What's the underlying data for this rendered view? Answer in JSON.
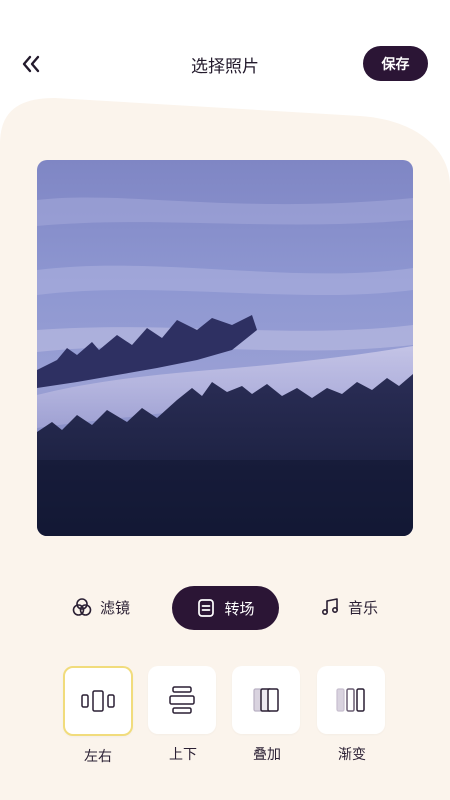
{
  "header": {
    "title": "选择照片",
    "save_label": "保存"
  },
  "tabs": [
    {
      "label": "滤镜",
      "icon": "filter-circles-icon",
      "active": false
    },
    {
      "label": "转场",
      "icon": "transition-icon",
      "active": true
    },
    {
      "label": "音乐",
      "icon": "music-note-icon",
      "active": false
    }
  ],
  "transitions": [
    {
      "label": "左右",
      "icon": "left-right-bars-icon",
      "selected": true
    },
    {
      "label": "上下",
      "icon": "up-down-bars-icon",
      "selected": false
    },
    {
      "label": "叠加",
      "icon": "overlay-bars-icon",
      "selected": false
    },
    {
      "label": "渐变",
      "icon": "gradient-bars-icon",
      "selected": false
    }
  ],
  "colors": {
    "accent_dark": "#2b1535",
    "panel_bg": "#fbf4ec",
    "selected_border": "#f1dc7c"
  }
}
